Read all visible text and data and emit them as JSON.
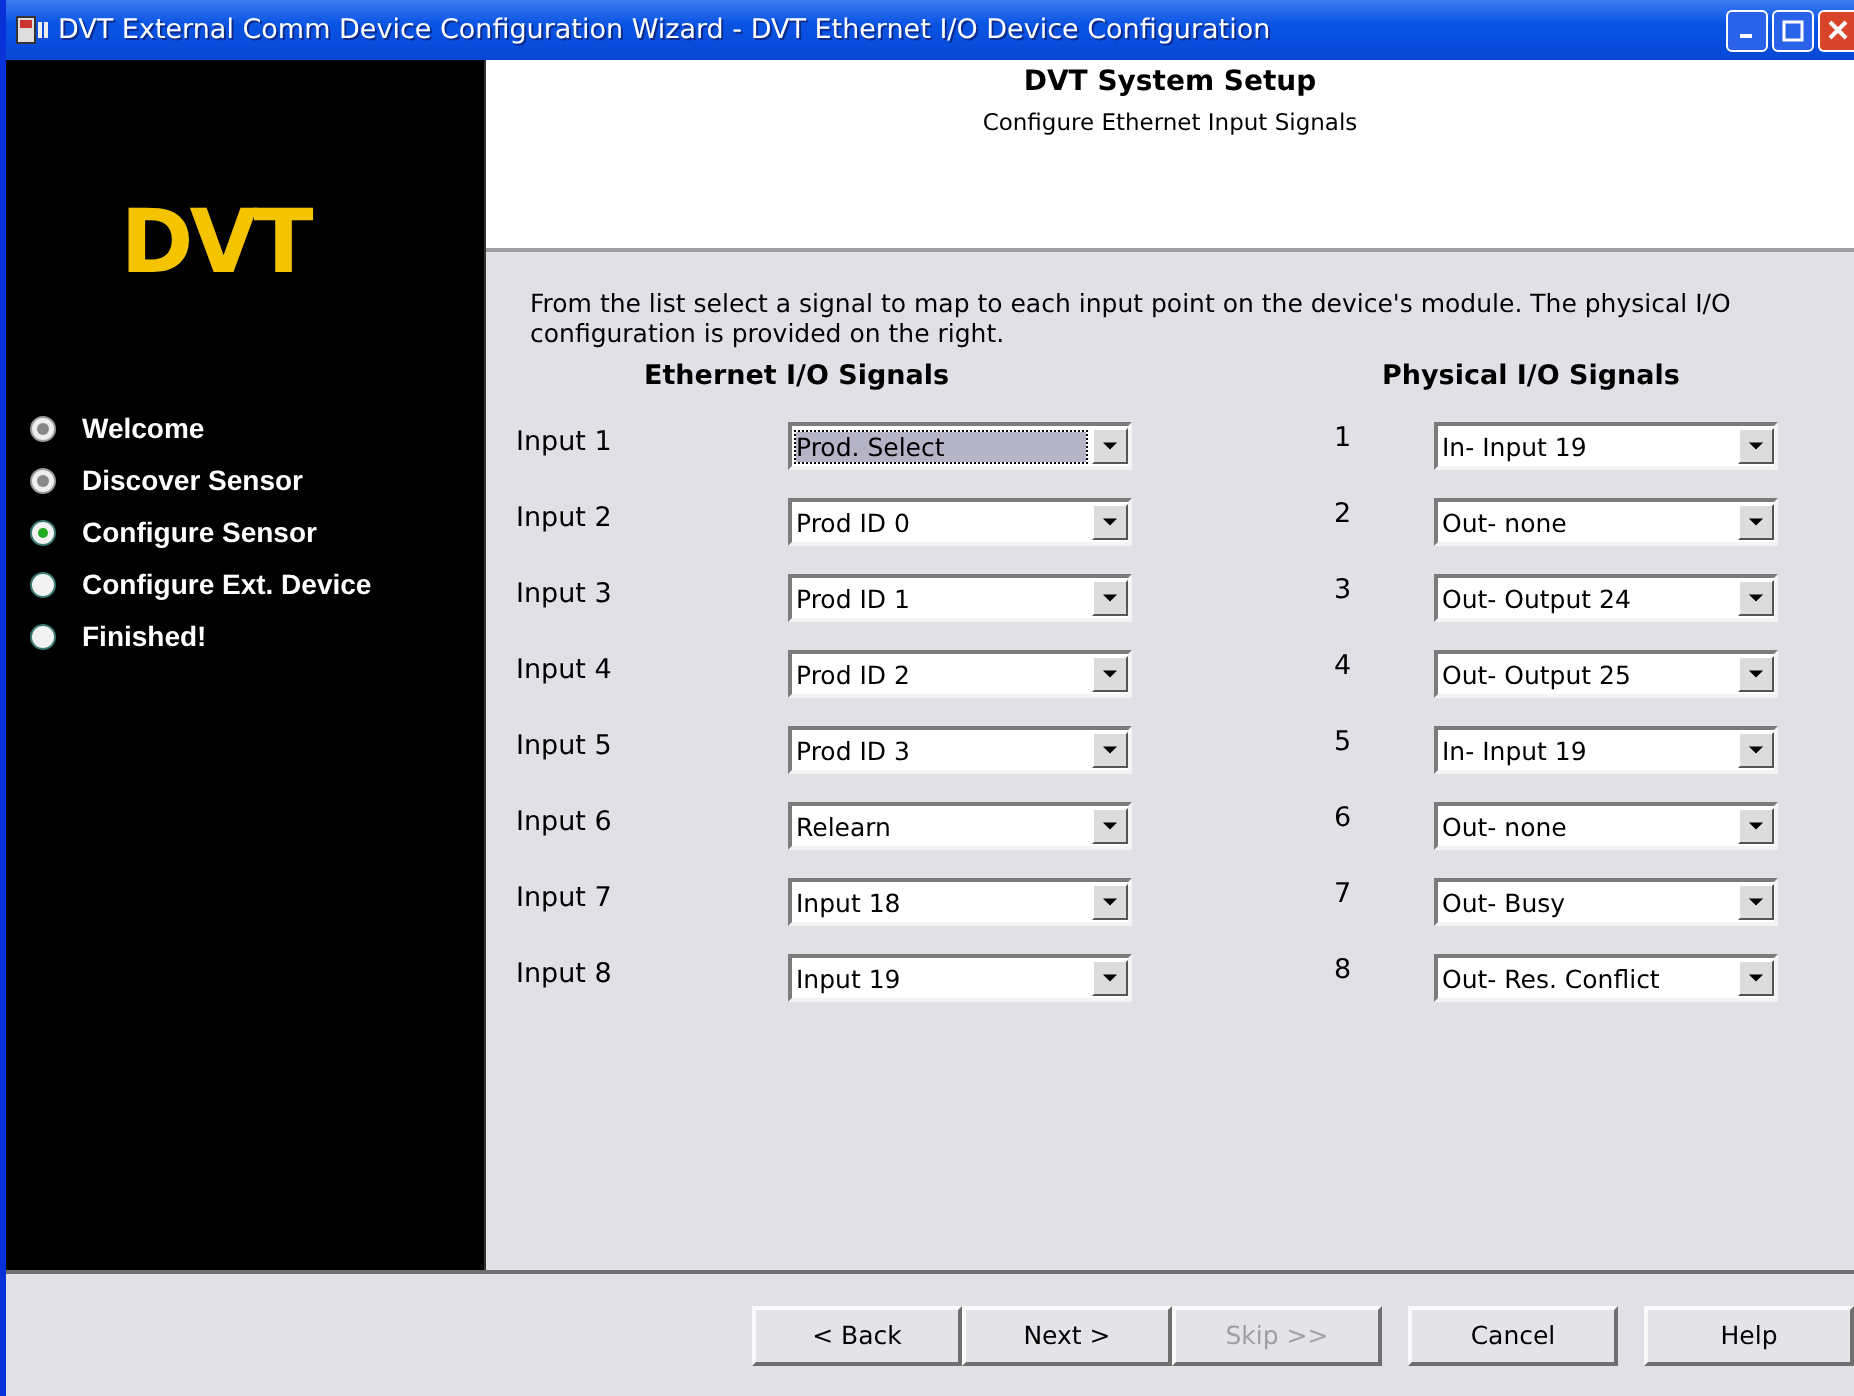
{
  "window": {
    "title": "DVT External Comm Device Configuration Wizard - DVT Ethernet I/O Device Configuration"
  },
  "sidebar": {
    "logo": "DVT",
    "steps": [
      {
        "label": "Welcome",
        "done": true,
        "selected": false
      },
      {
        "label": "Discover Sensor",
        "done": true,
        "selected": false
      },
      {
        "label": "Configure Sensor",
        "done": false,
        "selected": true
      },
      {
        "label": "Configure Ext. Device",
        "done": false,
        "selected": false
      },
      {
        "label": "Finished!",
        "done": false,
        "selected": false
      }
    ]
  },
  "header": {
    "title": "DVT System Setup",
    "subtitle": "Configure Ethernet Input Signals"
  },
  "instructions": "From the list select a signal to map to each input point on the device's module. The physical I/O configuration is provided on the right.",
  "ethernet": {
    "heading": "Ethernet I/O Signals",
    "rows": [
      {
        "label": "Input 1",
        "value": "Prod. Select",
        "focused": true
      },
      {
        "label": "Input 2",
        "value": "Prod ID 0",
        "focused": false
      },
      {
        "label": "Input 3",
        "value": "Prod ID 1",
        "focused": false
      },
      {
        "label": "Input 4",
        "value": "Prod ID 2",
        "focused": false
      },
      {
        "label": "Input 5",
        "value": "Prod ID 3",
        "focused": false
      },
      {
        "label": "Input 6",
        "value": "Relearn",
        "focused": false
      },
      {
        "label": "Input 7",
        "value": "Input 18",
        "focused": false
      },
      {
        "label": "Input 8",
        "value": "Input 19",
        "focused": false
      }
    ]
  },
  "physical": {
    "heading": "Physical I/O Signals",
    "rows": [
      {
        "label": "1",
        "value": "In- Input 19"
      },
      {
        "label": "2",
        "value": "Out- none"
      },
      {
        "label": "3",
        "value": "Out- Output 24"
      },
      {
        "label": "4",
        "value": "Out- Output 25"
      },
      {
        "label": "5",
        "value": "In- Input 19"
      },
      {
        "label": "6",
        "value": "Out- none"
      },
      {
        "label": "7",
        "value": "Out- Busy"
      },
      {
        "label": "8",
        "value": "Out- Res. Conflict"
      }
    ]
  },
  "buttons": [
    {
      "label": "< Back",
      "disabled": false
    },
    {
      "label": "Next >",
      "disabled": false
    },
    {
      "label": "Skip >>",
      "disabled": true
    },
    {
      "label": "Cancel",
      "disabled": false
    },
    {
      "label": "Help",
      "disabled": false
    }
  ]
}
